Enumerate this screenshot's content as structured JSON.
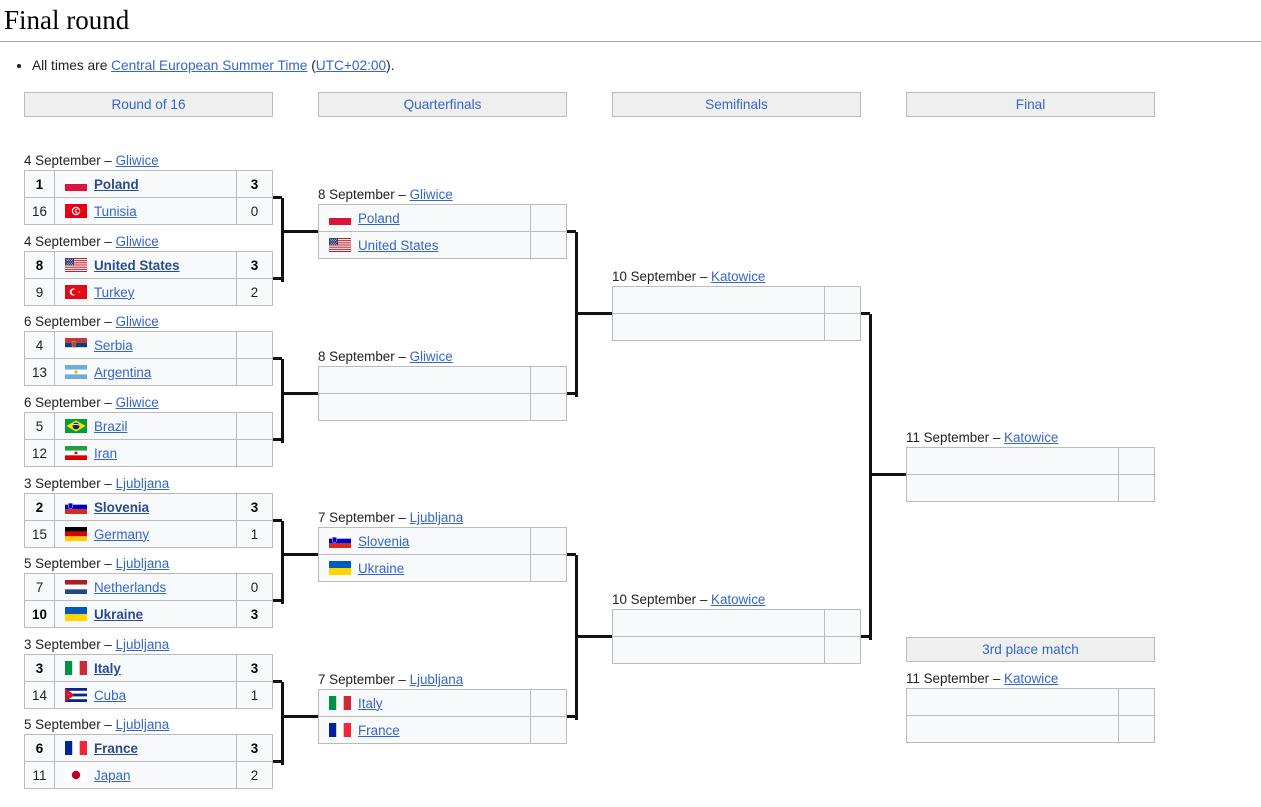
{
  "page": {
    "title": "Final round",
    "note_prefix": "All times are ",
    "note_link": "Central European Summer Time",
    "note_paren_open": " (",
    "note_utc": "UTC+02:00",
    "note_suffix": ")."
  },
  "round_headers": [
    {
      "label": "Round of 16"
    },
    {
      "label": "Quarterfinals"
    },
    {
      "label": "Semifinals"
    },
    {
      "label": "Final"
    }
  ],
  "third_place_header": "3rd place match",
  "colors": {
    "link": "#3366cc",
    "winner": "#2a4b8d",
    "header_bg": "#efefef",
    "border": "#bbbbbb",
    "cell_bg": "#f8f9fa"
  },
  "round_of_16": [
    {
      "date": "4 September",
      "sep": " – ",
      "venue": "Gliwice",
      "rows": [
        {
          "seed": "1",
          "team": "Poland",
          "flag": "poland-flag",
          "score": "3",
          "winner": true
        },
        {
          "seed": "16",
          "team": "Tunisia",
          "flag": "tunisia-flag",
          "score": "0",
          "winner": false
        }
      ]
    },
    {
      "date": "4 September",
      "sep": " – ",
      "venue": "Gliwice",
      "rows": [
        {
          "seed": "8",
          "team": "United States",
          "flag": "united-states-flag",
          "score": "3",
          "winner": true
        },
        {
          "seed": "9",
          "team": "Turkey",
          "flag": "turkey-flag",
          "score": "2",
          "winner": false
        }
      ]
    },
    {
      "date": "6 September",
      "sep": " – ",
      "venue": "Gliwice",
      "rows": [
        {
          "seed": "4",
          "team": "Serbia",
          "flag": "serbia-flag",
          "score": "",
          "winner": false
        },
        {
          "seed": "13",
          "team": "Argentina",
          "flag": "argentina-flag",
          "score": "",
          "winner": false
        }
      ]
    },
    {
      "date": "6 September",
      "sep": " – ",
      "venue": "Gliwice",
      "rows": [
        {
          "seed": "5",
          "team": "Brazil",
          "flag": "brazil-flag",
          "score": "",
          "winner": false
        },
        {
          "seed": "12",
          "team": "Iran",
          "flag": "iran-flag",
          "score": "",
          "winner": false
        }
      ]
    },
    {
      "date": "3 September",
      "sep": " – ",
      "venue": "Ljubljana",
      "rows": [
        {
          "seed": "2",
          "team": "Slovenia",
          "flag": "slovenia-flag",
          "score": "3",
          "winner": true
        },
        {
          "seed": "15",
          "team": "Germany",
          "flag": "germany-flag",
          "score": "1",
          "winner": false
        }
      ]
    },
    {
      "date": "5 September",
      "sep": " – ",
      "venue": "Ljubljana",
      "rows": [
        {
          "seed": "7",
          "team": "Netherlands",
          "flag": "netherlands-flag",
          "score": "0",
          "winner": false
        },
        {
          "seed": "10",
          "team": "Ukraine",
          "flag": "ukraine-flag",
          "score": "3",
          "winner": true
        }
      ]
    },
    {
      "date": "3 September",
      "sep": " – ",
      "venue": "Ljubljana",
      "rows": [
        {
          "seed": "3",
          "team": "Italy",
          "flag": "italy-flag",
          "score": "3",
          "winner": true
        },
        {
          "seed": "14",
          "team": "Cuba",
          "flag": "cuba-flag",
          "score": "1",
          "winner": false
        }
      ]
    },
    {
      "date": "5 September",
      "sep": " – ",
      "venue": "Ljubljana",
      "rows": [
        {
          "seed": "6",
          "team": "France",
          "flag": "france-flag",
          "score": "3",
          "winner": true
        },
        {
          "seed": "11",
          "team": "Japan",
          "flag": "japan-flag",
          "score": "2",
          "winner": false
        }
      ]
    }
  ],
  "quarterfinals": [
    {
      "date": "8 September",
      "sep": " – ",
      "venue": "Gliwice",
      "rows": [
        {
          "team": "Poland",
          "flag": "poland-flag",
          "score": "",
          "winner": false
        },
        {
          "team": "United States",
          "flag": "united-states-flag",
          "score": "",
          "winner": false
        }
      ]
    },
    {
      "date": "8 September",
      "sep": " – ",
      "venue": "Gliwice",
      "rows": [
        {
          "team": "",
          "flag": "",
          "score": "",
          "winner": false
        },
        {
          "team": "",
          "flag": "",
          "score": "",
          "winner": false
        }
      ]
    },
    {
      "date": "7 September",
      "sep": " – ",
      "venue": "Ljubljana",
      "rows": [
        {
          "team": "Slovenia",
          "flag": "slovenia-flag",
          "score": "",
          "winner": false
        },
        {
          "team": "Ukraine",
          "flag": "ukraine-flag",
          "score": "",
          "winner": false
        }
      ]
    },
    {
      "date": "7 September",
      "sep": " – ",
      "venue": "Ljubljana",
      "rows": [
        {
          "team": "Italy",
          "flag": "italy-flag",
          "score": "",
          "winner": false
        },
        {
          "team": "France",
          "flag": "france-flag",
          "score": "",
          "winner": false
        }
      ]
    }
  ],
  "semifinals": [
    {
      "date": "10 September",
      "sep": " – ",
      "venue": "Katowice",
      "rows": [
        {
          "team": "",
          "flag": "",
          "score": "",
          "winner": false
        },
        {
          "team": "",
          "flag": "",
          "score": "",
          "winner": false
        }
      ]
    },
    {
      "date": "10 September",
      "sep": " – ",
      "venue": "Katowice",
      "rows": [
        {
          "team": "",
          "flag": "",
          "score": "",
          "winner": false
        },
        {
          "team": "",
          "flag": "",
          "score": "",
          "winner": false
        }
      ]
    }
  ],
  "final": {
    "date": "11 September",
    "sep": " – ",
    "venue": "Katowice",
    "rows": [
      {
        "team": "",
        "flag": "",
        "score": "",
        "winner": false
      },
      {
        "team": "",
        "flag": "",
        "score": "",
        "winner": false
      }
    ]
  },
  "third_place": {
    "date": "11 September",
    "sep": " – ",
    "venue": "Katowice",
    "rows": [
      {
        "team": "",
        "flag": "",
        "score": "",
        "winner": false
      },
      {
        "team": "",
        "flag": "",
        "score": "",
        "winner": false
      }
    ]
  }
}
